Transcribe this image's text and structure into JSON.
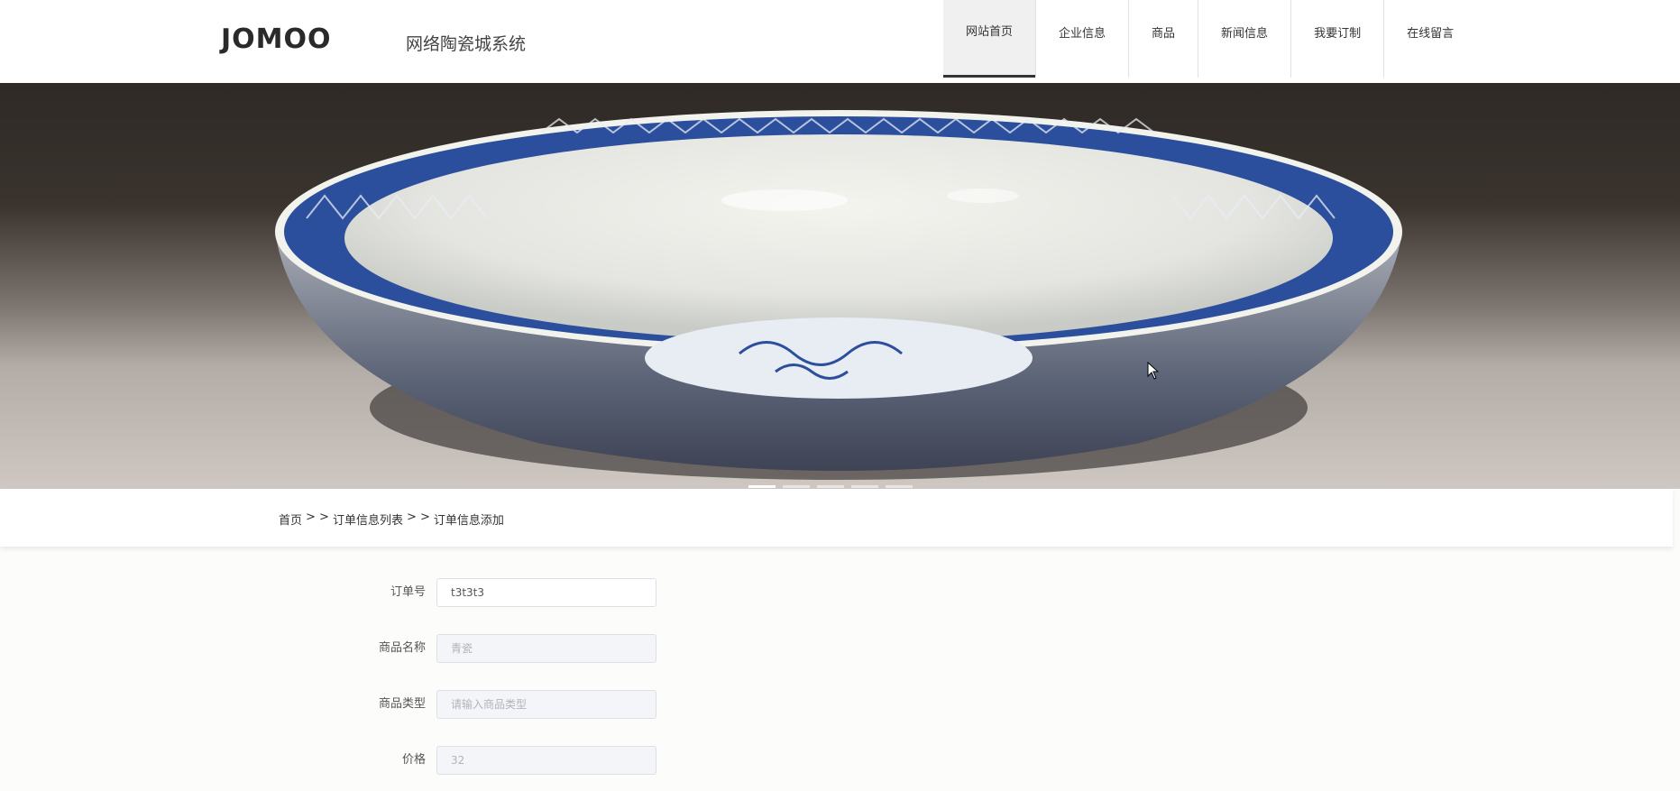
{
  "header": {
    "logo": "JOMOO",
    "site_title": "网络陶瓷城系统",
    "nav": [
      {
        "label": "网站首页",
        "active": true
      },
      {
        "label": "企业信息",
        "active": false
      },
      {
        "label": "商品",
        "active": false
      },
      {
        "label": "新闻信息",
        "active": false
      },
      {
        "label": "我要订制",
        "active": false
      },
      {
        "label": "在线留言",
        "active": false
      }
    ]
  },
  "banner": {
    "slide_count": 5,
    "active_slide": 1
  },
  "breadcrumb": {
    "home": "首页",
    "sep": "> >",
    "list": "订单信息列表",
    "current": "订单信息添加"
  },
  "form": {
    "order_no": {
      "label": "订单号",
      "value": "t3t3t3",
      "placeholder": ""
    },
    "product_name": {
      "label": "商品名称",
      "value": "",
      "placeholder": "青瓷"
    },
    "product_type": {
      "label": "商品类型",
      "value": "",
      "placeholder": "请输入商品类型"
    },
    "price": {
      "label": "价格",
      "value": "",
      "placeholder": "32"
    }
  },
  "colors": {
    "nav_active_bg": "#f0f0f0",
    "page_bg": "#fcfdfb",
    "porcelain_blue": "#2b4f9c"
  }
}
